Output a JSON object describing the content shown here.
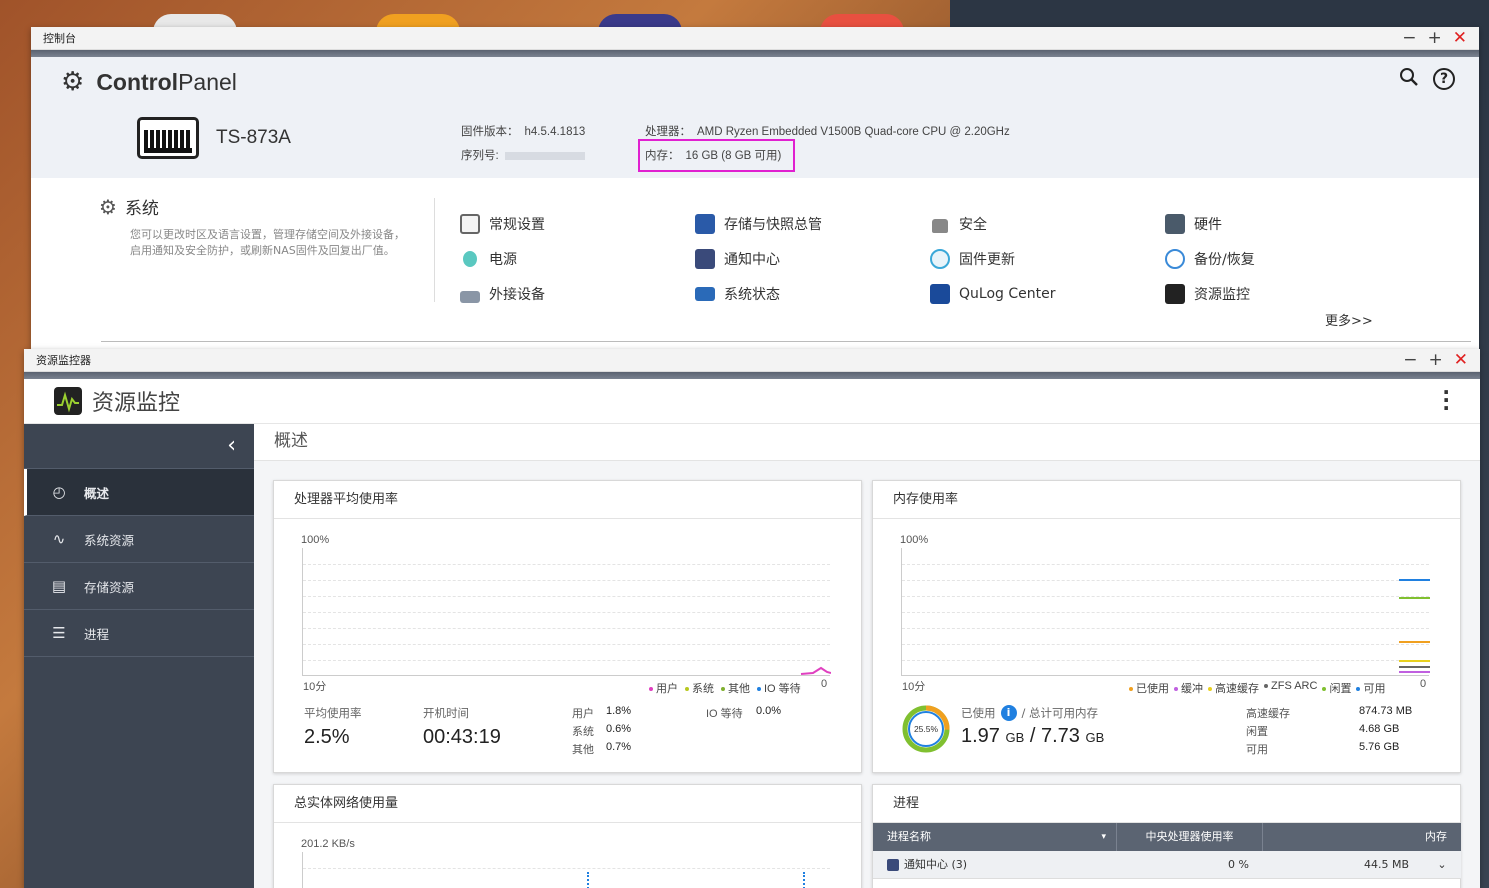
{
  "control_panel": {
    "window_title": "控制台",
    "app_name_bold": "Control",
    "app_name_rest": "Panel",
    "model": "TS-873A",
    "firmware_label": "固件版本：",
    "firmware_value": "h4.5.4.1813",
    "serial_label": "序列号:",
    "cpu_label": "处理器：",
    "cpu_value": "AMD Ryzen Embedded V1500B Quad-core CPU @ 2.20GHz",
    "memory_label": "内存：",
    "memory_value": "16 GB (8 GB 可用)",
    "system_title": "系统",
    "system_desc": "您可以更改时区及语言设置，管理存储空间及外接设备，启用通知及安全防护，或刷新NAS固件及回复出厂值。",
    "items": [
      {
        "label": "常规设置",
        "icon": "settings-doc-icon"
      },
      {
        "label": "存储与快照总管",
        "icon": "storage-icon"
      },
      {
        "label": "安全",
        "icon": "lock-icon"
      },
      {
        "label": "硬件",
        "icon": "hardware-icon"
      },
      {
        "label": "电源",
        "icon": "bulb-icon"
      },
      {
        "label": "通知中心",
        "icon": "notification-icon"
      },
      {
        "label": "固件更新",
        "icon": "firmware-update-icon"
      },
      {
        "label": "备份/恢复",
        "icon": "backup-icon"
      },
      {
        "label": "外接设备",
        "icon": "external-device-icon"
      },
      {
        "label": "系统状态",
        "icon": "monitor-icon"
      },
      {
        "label": "QuLog Center",
        "icon": "qulog-icon"
      },
      {
        "label": "资源监控",
        "icon": "resource-monitor-icon"
      }
    ],
    "more": "更多>>"
  },
  "resource_monitor": {
    "window_title": "资源监控器",
    "app_title": "资源监控",
    "page_title": "概述",
    "nav": [
      {
        "label": "概述",
        "icon": "dashboard-icon"
      },
      {
        "label": "系统资源",
        "icon": "line-chart-icon"
      },
      {
        "label": "存储资源",
        "icon": "disk-icon"
      },
      {
        "label": "进程",
        "icon": "process-list-icon"
      }
    ],
    "cpu_card": {
      "title": "处理器平均使用率",
      "y_max": "100%",
      "x_min": "10分",
      "x_max": "0",
      "legend": [
        "用户",
        "系统",
        "其他",
        "IO 等待"
      ],
      "avg_label": "平均使用率",
      "avg_value": "2.5%",
      "uptime_label": "开机时间",
      "uptime_value": "00:43:19",
      "user_label": "用户",
      "user_value": "1.8%",
      "system_label": "系统",
      "system_value": "0.6%",
      "other_label": "其他",
      "other_value": "0.7%",
      "io_label": "IO 等待",
      "io_value": "0.0%"
    },
    "mem_card": {
      "title": "内存使用率",
      "y_max": "100%",
      "x_min": "10分",
      "x_max": "0",
      "legend": [
        "已使用",
        "缓冲",
        "高速缓存",
        "ZFS ARC",
        "闲置",
        "可用"
      ],
      "used_pct": "25.5%",
      "used_pct_value": 25.5,
      "used_label": "已使用",
      "total_label": "/ 总计可用内存",
      "used_value": "1.97",
      "total_value": "7.73",
      "unit": "GB",
      "cache_label": "高速缓存",
      "cache_value": "874.73 MB",
      "free_label": "闲置",
      "free_value": "4.68 GB",
      "avail_label": "可用",
      "avail_value": "5.76 GB"
    },
    "net_card": {
      "title": "总实体网络使用量",
      "y_max": "201.2 KB/s"
    },
    "proc_card": {
      "title": "进程",
      "col_name": "进程名称",
      "col_cpu": "中央处理器使用率",
      "col_mem": "内存",
      "row_name": "通知中心 (3)",
      "row_cpu": "0 %",
      "row_mem": "44.5 MB"
    }
  },
  "colors": {
    "accent_magenta": "#e020d0",
    "sidebar_bg": "#3d4552",
    "legend_user": "#e040c0",
    "legend_system": "#b8c820",
    "legend_other": "#80b030",
    "legend_io": "#2080e0",
    "mem_used": "#f0a020",
    "mem_buffer": "#c060e0",
    "mem_cache": "#e8d020",
    "mem_zfs": "#666666",
    "mem_free": "#999999",
    "mem_avail": "#2080e0"
  }
}
